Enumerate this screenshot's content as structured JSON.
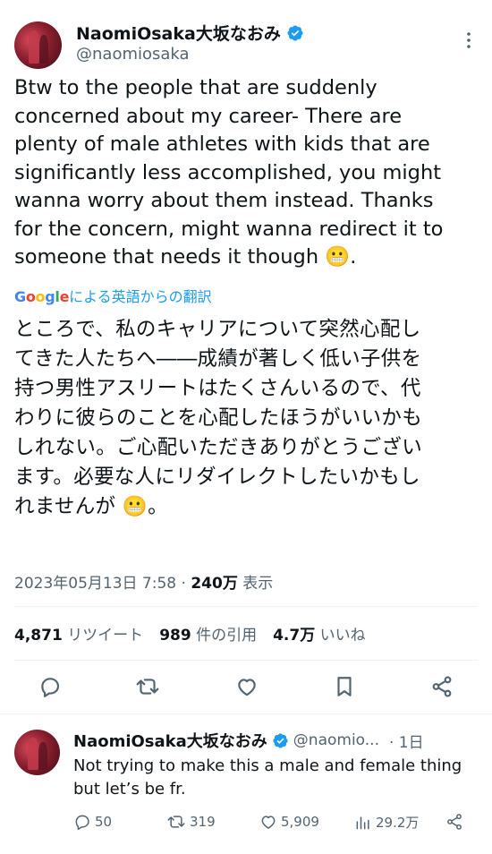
{
  "tweet": {
    "author_name": "NaomiOsaka大坂なおみ",
    "author_handle": "@naomiosaka",
    "text_lines": [
      "Btw to the people that are suddenly",
      "concerned about my career- There are",
      "plenty of male athletes with kids that are",
      "significantly less accomplished, you might",
      "wanna worry about them instead. Thanks",
      "for the concern, might wanna redirect it to",
      "someone that needs it though 😬."
    ],
    "translate_label": "による英語からの翻訳",
    "google_letters": [
      "G",
      "o",
      "o",
      "g",
      "l",
      "e"
    ],
    "translation_lines": [
      "ところで、私のキャリアについて突然心配し",
      "てきた人たちへ――成績が著しく低い子供を",
      "持つ男性アスリートはたくさんいるので、代",
      "わりに彼らのことを心配したほうがいいかも",
      "しれない。ご心配いただきありがとうござい",
      "ます。必要な人にリダイレクトしたいかもし",
      "れませんが 😬。"
    ],
    "timestamp": "2023年05月13日 7:58",
    "separator": " · ",
    "views_count": "240万",
    "views_label": " 表示",
    "retweets_count": "4,871",
    "retweets_label": "リツイート",
    "quotes_count": "989",
    "quotes_label": "件の引用",
    "likes_count": "4.7万",
    "likes_label": "いいね"
  },
  "reply": {
    "author_name": "NaomiOsaka大坂なおみ",
    "author_handle": "@naomio...",
    "time": "· 1日",
    "text_lines": [
      "Not trying to make this a male and female thing",
      "but let’s be fr."
    ],
    "replies": "50",
    "retweets": "319",
    "likes": "5,909",
    "views": "29.2万"
  },
  "colors": {
    "accent": "#1d9bf0",
    "secondary_text": "#536471",
    "google_blue": "#4285f4",
    "google_red": "#ea4335",
    "google_yellow": "#fbbc05",
    "google_green": "#34a853"
  }
}
